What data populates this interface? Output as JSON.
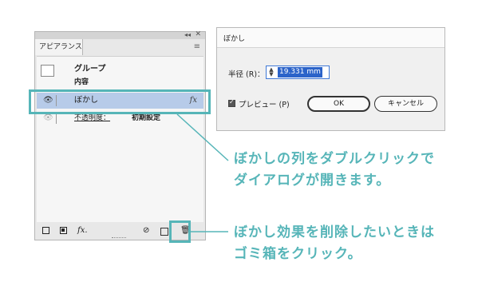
{
  "panel": {
    "tab_label": "アピアランス",
    "rows": {
      "group": "グループ",
      "content": "内容",
      "blur": "ぼかし",
      "opacity_label": "不透明度：",
      "opacity_value": "初期設定"
    },
    "fx_glyph": "fx",
    "bottom_fx_glyph": "fx."
  },
  "dialog": {
    "title": "ぼかし",
    "radius_label": "半径 (R)：",
    "radius_value": "19.331 mm",
    "preview_label": "プレビュー (P)",
    "ok_label": "OK",
    "cancel_label": "キャンセル"
  },
  "annotations": {
    "note1_line1": "ぼかしの列をダブルクリックで",
    "note1_line2": "ダイアログが開きます。",
    "note2_line1": "ぼかし効果を削除したいときは",
    "note2_line2": "ゴミ箱をクリック。"
  },
  "colors": {
    "accent": "#56b5b8",
    "row_selected": "#b7cbe9",
    "input_selection": "#2b63c9"
  }
}
